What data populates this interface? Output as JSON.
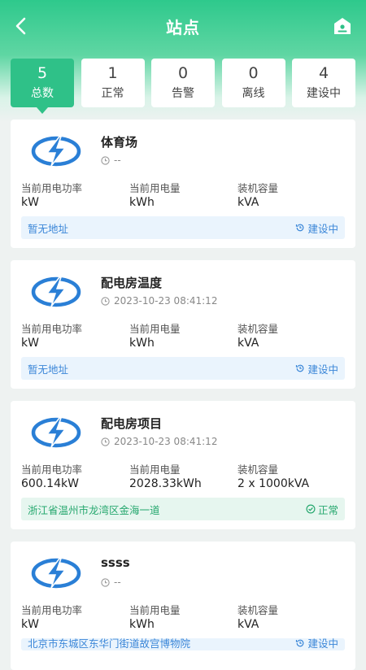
{
  "header": {
    "title": "站点"
  },
  "tabs": [
    {
      "count": "5",
      "label": "总数",
      "active": true
    },
    {
      "count": "1",
      "label": "正常"
    },
    {
      "count": "0",
      "label": "告警"
    },
    {
      "count": "0",
      "label": "离线"
    },
    {
      "count": "4",
      "label": "建设中"
    }
  ],
  "labels": {
    "power": "当前用电功率",
    "energy": "当前用电量",
    "capacity": "装机容量"
  },
  "stations": [
    {
      "name": "体育场",
      "time": "--",
      "power": "kW",
      "energy": "kWh",
      "capacity": "kVA",
      "address": "暂无地址",
      "status": "建设中",
      "status_type": "building"
    },
    {
      "name": "配电房温度",
      "time": "2023-10-23 08:41:12",
      "power": "kW",
      "energy": "kWh",
      "capacity": "kVA",
      "address": "暂无地址",
      "status": "建设中",
      "status_type": "building"
    },
    {
      "name": "配电房项目",
      "time": "2023-10-23 08:41:12",
      "power": "600.14kW",
      "energy": "2028.33kWh",
      "capacity": "2 x 1000kVA",
      "address": "浙江省温州市龙湾区金海一道",
      "status": "正常",
      "status_type": "normal"
    },
    {
      "name": "ssss",
      "time": "--",
      "power": "kW",
      "energy": "kWh",
      "capacity": "kVA",
      "address": "北京市东城区东华门街道故宫博物院",
      "status": "建设中",
      "status_type": "building"
    }
  ],
  "colors": {
    "accent": "#2fc188",
    "building": "#3a86d8",
    "normal": "#27a86f"
  }
}
